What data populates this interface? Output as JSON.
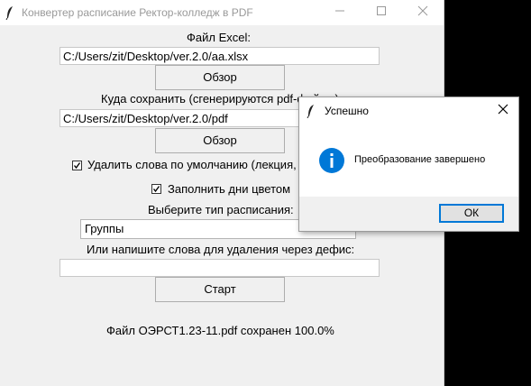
{
  "window": {
    "title": "Конвертер расписание Ректор-колледж в PDF",
    "minimize_icon": "minimize-icon",
    "maximize_icon": "maximize-icon",
    "close_icon": "close-icon"
  },
  "form": {
    "excel_label": "Файл Excel:",
    "excel_path": "C:/Users/zit/Desktop/ver.2.0/aa.xlsx",
    "browse_label": "Обзор",
    "save_label": "Куда сохранить (сгенерируются pdf-файлы):",
    "save_path": "C:/Users/zit/Desktop/ver.2.0/pdf",
    "remove_default_label": "Удалить слова по умолчанию (лекция, практика):",
    "remove_default_checked": true,
    "fill_color_label": "Заполнить дни цветом",
    "fill_color_checked": true,
    "schedule_type_label": "Выберите тип расписания:",
    "schedule_type_value": "Группы",
    "words_label": "Или напишите слова для удаления через дефис:",
    "words_value": "",
    "start_label": "Старт",
    "status": "Файл ОЭРСТ1.23-11.pdf сохранен 100.0%"
  },
  "dialog": {
    "title": "Успешно",
    "message": "Преобразование завершено",
    "ok_label": "ОК",
    "icon": "info-icon",
    "accent_color": "#0078d7"
  }
}
